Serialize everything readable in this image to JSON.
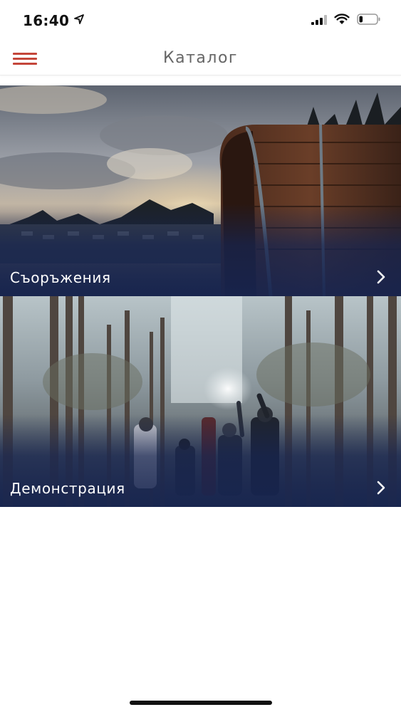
{
  "status_bar": {
    "time": "16:40",
    "location_icon": "location-arrow-icon",
    "signal_icon": "cellular-signal-icon",
    "wifi_icon": "wifi-icon",
    "battery_icon": "battery-icon",
    "battery_level": 0.2
  },
  "nav": {
    "title": "Каталог",
    "menu_icon": "hamburger-menu-icon",
    "accent_color": "#c4463a"
  },
  "catalog": {
    "items": [
      {
        "label": "Съоръжения",
        "image": "barrel-sauna-sunset-photo",
        "chevron_icon": "chevron-right-icon"
      },
      {
        "label": "Демонстрация",
        "image": "family-in-winter-forest-photo",
        "chevron_icon": "chevron-right-icon"
      }
    ],
    "overlay_color": "#162450"
  }
}
